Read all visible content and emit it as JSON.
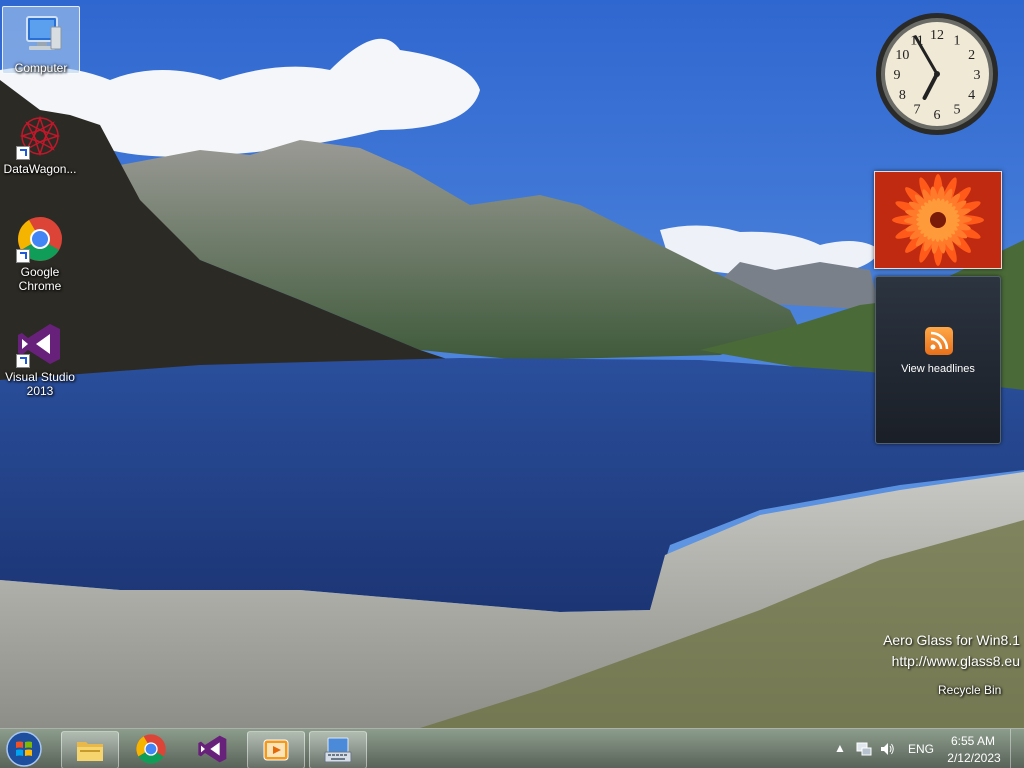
{
  "desktop": {
    "icons": [
      {
        "label": "Computer",
        "icon": "computer-icon"
      },
      {
        "label": "DataWagon...",
        "icon": "datawagon-icon"
      },
      {
        "label": "Google Chrome",
        "icon": "chrome-icon"
      },
      {
        "label": "Visual Studio 2013",
        "icon": "visual-studio-icon"
      }
    ],
    "recycle_bin": {
      "label": "Recycle Bin"
    }
  },
  "gadgets": {
    "clock": {
      "numbers": [
        "12",
        "1",
        "2",
        "3",
        "4",
        "5",
        "6",
        "7",
        "8",
        "9",
        "10",
        "11"
      ],
      "hour": 6,
      "minute": 55
    },
    "slideshow": {
      "icon": "flower-photo"
    },
    "feeds": {
      "label": "View headlines",
      "icon": "rss-icon"
    }
  },
  "watermark": {
    "line1": "Aero Glass for Win8.1",
    "line2": "http://www.glass8.eu"
  },
  "taskbar": {
    "start": {
      "icon": "windows-start-icon"
    },
    "pinned": [
      {
        "name": "file-explorer",
        "icon": "folder-icon"
      },
      {
        "name": "chrome",
        "icon": "chrome-icon"
      },
      {
        "name": "visual-studio",
        "icon": "visual-studio-icon"
      },
      {
        "name": "media-player",
        "icon": "media-player-icon"
      },
      {
        "name": "on-screen-keyboard",
        "icon": "keyboard-icon"
      }
    ],
    "tray": {
      "language": "ENG",
      "time": "6:55 AM",
      "date": "2/12/2023"
    }
  },
  "colors": {
    "sky": "#3a72d0",
    "lake": "#1d3f8a",
    "taskbar": "#5a6a5a",
    "rss": "#f08a24",
    "vs_purple": "#68217a"
  }
}
